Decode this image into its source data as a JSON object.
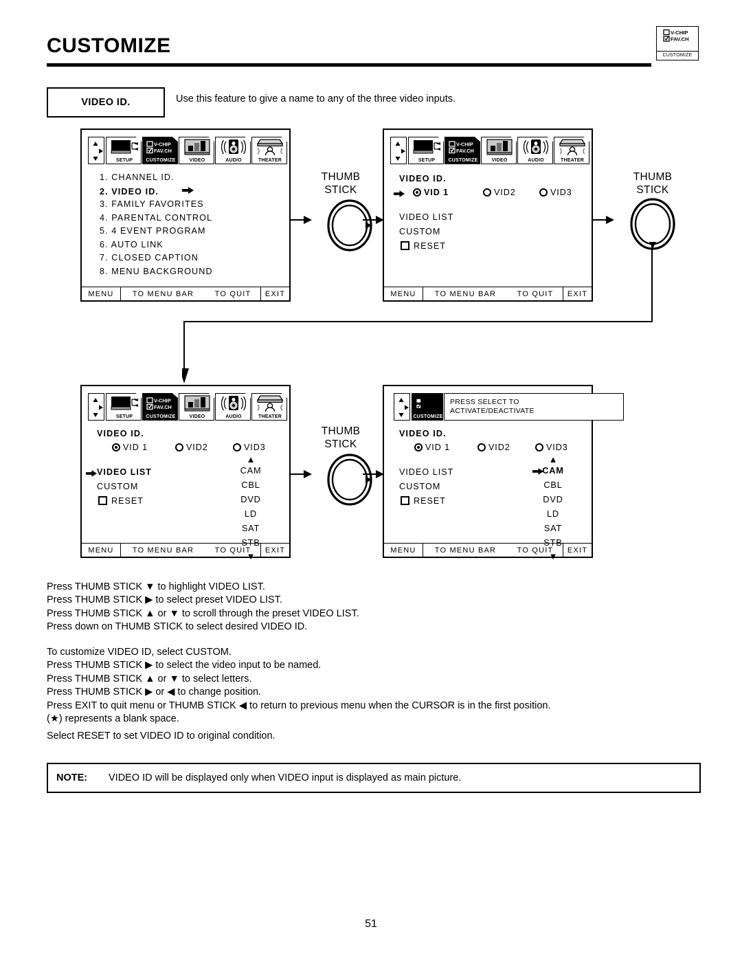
{
  "page": {
    "title": "CUSTOMIZE",
    "number": "51"
  },
  "corner_badge": {
    "icon": "vchip-favch-icon",
    "label": "CUSTOMIZE",
    "chip_line1": "V-CHIP",
    "chip_line2": "FAV.CH"
  },
  "feature": {
    "name": "VIDEO ID.",
    "description": "Use this feature to give a name to any of the three video inputs."
  },
  "menubar": {
    "navpad_icon": "nav-pad-icon",
    "tabs": [
      {
        "label": "SETUP",
        "icon": "tv-setup-icon",
        "selected": false
      },
      {
        "label": "CUSTOMIZE",
        "icon": "vchip-favch-icon",
        "selected": true
      },
      {
        "label": "VIDEO",
        "icon": "bars-video-icon",
        "selected": false
      },
      {
        "label": "AUDIO",
        "icon": "speaker-audio-icon",
        "selected": false
      },
      {
        "label": "THEATER",
        "icon": "theater-seat-icon",
        "selected": false
      }
    ]
  },
  "footer": {
    "menu": "MENU",
    "to_menu_bar": "TO MENU BAR",
    "to_quit": "TO QUIT",
    "exit": "EXIT"
  },
  "screen1": {
    "items": [
      {
        "text": "1. CHANNEL ID.",
        "highlight": false,
        "cursor": false
      },
      {
        "text": "2. VIDEO ID.",
        "highlight": true,
        "cursor": true
      },
      {
        "text": "3. FAMILY FAVORITES",
        "highlight": false,
        "cursor": false
      },
      {
        "text": "4. PARENTAL CONTROL",
        "highlight": false,
        "cursor": false
      },
      {
        "text": "5. 4 EVENT PROGRAM",
        "highlight": false,
        "cursor": false
      },
      {
        "text": "6. AUTO LINK",
        "highlight": false,
        "cursor": false
      },
      {
        "text": "7. CLOSED CAPTION",
        "highlight": false,
        "cursor": false
      },
      {
        "text": "8. MENU BACKGROUND",
        "highlight": false,
        "cursor": false
      }
    ]
  },
  "screen2": {
    "heading": "VIDEO ID.",
    "cursor_on_vid1": true,
    "inputs": [
      {
        "label": "VID 1",
        "selected": true,
        "bold": true
      },
      {
        "label": "VID2",
        "selected": false,
        "bold": false
      },
      {
        "label": "VID3",
        "selected": false,
        "bold": false
      }
    ],
    "options": [
      {
        "label": "VIDEO LIST",
        "type": "text",
        "highlight": false,
        "cursor": false
      },
      {
        "label": "CUSTOM",
        "type": "text",
        "highlight": false,
        "cursor": false
      },
      {
        "label": "RESET",
        "type": "checkbox",
        "highlight": false,
        "cursor": false
      }
    ]
  },
  "screen3": {
    "heading": "VIDEO ID.",
    "inputs": [
      {
        "label": "VID 1",
        "selected": true,
        "bold": false
      },
      {
        "label": "VID2",
        "selected": false,
        "bold": false
      },
      {
        "label": "VID3",
        "selected": false,
        "bold": false
      }
    ],
    "options": [
      {
        "label": "VIDEO  LIST",
        "type": "text",
        "highlight": true,
        "cursor": true
      },
      {
        "label": "CUSTOM",
        "type": "text",
        "highlight": false,
        "cursor": false
      },
      {
        "label": "RESET",
        "type": "checkbox",
        "highlight": false,
        "cursor": false
      }
    ],
    "preset_list": {
      "scroll_up": "▲",
      "scroll_down": "▼",
      "items": [
        {
          "label": "CAM",
          "cursor": false,
          "bold": false
        },
        {
          "label": "CBL",
          "cursor": false,
          "bold": false
        },
        {
          "label": "DVD",
          "cursor": false,
          "bold": false
        },
        {
          "label": "LD",
          "cursor": false,
          "bold": false
        },
        {
          "label": "SAT",
          "cursor": false,
          "bold": false
        },
        {
          "label": "STB",
          "cursor": false,
          "bold": false
        }
      ]
    }
  },
  "screen4": {
    "heading": "VIDEO ID.",
    "info_tab": {
      "icon": "vchip-favch-icon",
      "label": "CUSTOMIZE",
      "line1": "PRESS SELECT TO",
      "line2": "ACTIVATE/DEACTIVATE"
    },
    "inputs": [
      {
        "label": "VID 1",
        "selected": true,
        "bold": false
      },
      {
        "label": "VID2",
        "selected": false,
        "bold": false
      },
      {
        "label": "VID3",
        "selected": false,
        "bold": false
      }
    ],
    "options": [
      {
        "label": "VIDEO  LIST",
        "type": "text",
        "highlight": false,
        "cursor": false
      },
      {
        "label": "CUSTOM",
        "type": "text",
        "highlight": false,
        "cursor": false
      },
      {
        "label": "RESET",
        "type": "checkbox",
        "highlight": false,
        "cursor": false
      }
    ],
    "preset_list": {
      "scroll_up": "▲",
      "scroll_down": "▼",
      "items": [
        {
          "label": "CAM",
          "cursor": true,
          "bold": true
        },
        {
          "label": "CBL",
          "cursor": false,
          "bold": false
        },
        {
          "label": "DVD",
          "cursor": false,
          "bold": false
        },
        {
          "label": "LD",
          "cursor": false,
          "bold": false
        },
        {
          "label": "SAT",
          "cursor": false,
          "bold": false
        },
        {
          "label": "STB",
          "cursor": false,
          "bold": false
        }
      ]
    }
  },
  "thumbsticks": [
    {
      "line1": "THUMB",
      "line2": "STICK",
      "direction": "right"
    },
    {
      "line1": "THUMB",
      "line2": "STICK",
      "direction": "down"
    },
    {
      "line1": "THUMB",
      "line2": "STICK",
      "direction": "right"
    }
  ],
  "instructions": {
    "group1": [
      "Press THUMB STICK ▼ to highlight VIDEO LIST.",
      "Press THUMB STICK ▶ to select preset VIDEO LIST.",
      "Press THUMB STICK ▲ or ▼ to scroll through the preset VIDEO LIST.",
      "Press down on THUMB STICK to select desired VIDEO ID."
    ],
    "group2": [
      "To customize VIDEO ID, select CUSTOM.",
      "Press THUMB STICK ▶ to select the video input to be named.",
      "Press THUMB STICK ▲ or ▼ to select letters.",
      "Press THUMB STICK ▶ or ◀ to change position.",
      "Press EXIT to quit menu or THUMB STICK ◀ to return to previous menu when the CURSOR is in the first position.",
      "(★) represents a blank space."
    ],
    "group3": [
      "Select RESET to set VIDEO ID to original condition."
    ]
  },
  "note": {
    "label": "NOTE:",
    "text": "VIDEO ID will be displayed only when VIDEO input is displayed as main picture."
  }
}
